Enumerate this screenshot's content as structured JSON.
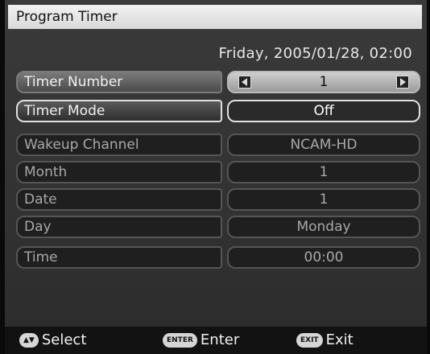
{
  "window": {
    "title": "Program Timer"
  },
  "datetime": "Friday, 2005/01/28, 02:00",
  "rows": [
    {
      "label": "Timer Number",
      "value": "1"
    },
    {
      "label": "Timer Mode",
      "value": "Off"
    },
    {
      "label": "Wakeup Channel",
      "value": "NCAM-HD"
    },
    {
      "label": "Month",
      "value": "1"
    },
    {
      "label": "Date",
      "value": "1"
    },
    {
      "label": "Day",
      "value": "Monday"
    },
    {
      "label": "Time",
      "value": "00:00"
    }
  ],
  "footer": {
    "select": {
      "key": "▲▼",
      "label": "Select"
    },
    "enter": {
      "key": "ENTER",
      "label": "Enter"
    },
    "exit": {
      "key": "EXIT",
      "label": "Exit"
    }
  },
  "icons": [
    "arrow-left-icon",
    "arrow-right-icon"
  ]
}
